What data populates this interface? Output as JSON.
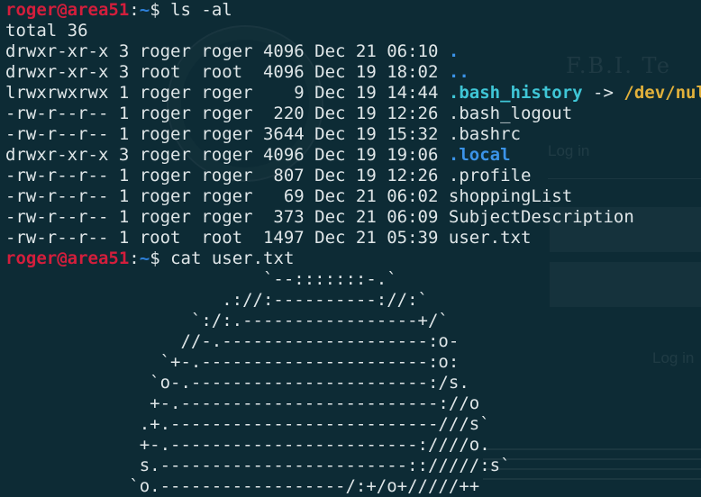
{
  "theme": {
    "background": "#0d2b35",
    "text": "#dfe6e8",
    "prompt_red": "#d31e3c",
    "dir_blue": "#3b93e8",
    "symlink_cyan": "#3fc6d6",
    "target_yellow": "#e2b13b"
  },
  "background_page": {
    "title": "F.B.I. Te",
    "login_label": "Log in",
    "login_button": "Log in"
  },
  "prompt": {
    "user": "roger",
    "at": "@",
    "host": "area51",
    "colon": ":",
    "path": "~",
    "symbol": "$"
  },
  "commands": {
    "first": "ls -al",
    "second": "cat user.txt"
  },
  "total_line": "total 36",
  "listing": [
    {
      "meta": "drwxr-xr-x 3 roger roger 4096 Dec 21 06:10 ",
      "name": ".",
      "type": "dir"
    },
    {
      "meta": "drwxr-xr-x 3 root  root  4096 Dec 19 18:02 ",
      "name": "..",
      "type": "dir"
    },
    {
      "meta": "lrwxrwxrwx 1 roger roger    9 Dec 19 14:44 ",
      "name": ".bash_history",
      "type": "link",
      "arrow": " -> ",
      "target": "/dev/null"
    },
    {
      "meta": "-rw-r--r-- 1 roger roger  220 Dec 19 12:26 ",
      "name": ".bash_logout",
      "type": "file"
    },
    {
      "meta": "-rw-r--r-- 1 roger roger 3644 Dec 19 15:32 ",
      "name": ".bashrc",
      "type": "file"
    },
    {
      "meta": "drwxr-xr-x 3 roger roger 4096 Dec 19 19:06 ",
      "name": ".local",
      "type": "dir"
    },
    {
      "meta": "-rw-r--r-- 1 roger roger  807 Dec 19 12:26 ",
      "name": ".profile",
      "type": "file"
    },
    {
      "meta": "-rw-r--r-- 1 roger roger   69 Dec 21 06:02 ",
      "name": "shoppingList",
      "type": "file"
    },
    {
      "meta": "-rw-r--r-- 1 roger roger  373 Dec 21 06:09 ",
      "name": "SubjectDescription",
      "type": "file"
    },
    {
      "meta": "-rw-r--r-- 1 root  root  1497 Dec 21 05:39 ",
      "name": "user.txt",
      "type": "file"
    }
  ],
  "ascii_art": [
    "                         `--:::::::-.`",
    "                     .://:----------://:`",
    "                  `:/:.-----------------+/`",
    "                 //-.--------------------:o-",
    "               `+-.----------------------:o:",
    "              `o-.-----------------------:/s.",
    "              +-.-------------------------://o",
    "             .+.--------------------------///s`",
    "             +-.------------------------:////o.",
    "             s.------------------------:://///:s`",
    "            `o.------------------/:+/o+/////++"
  ]
}
